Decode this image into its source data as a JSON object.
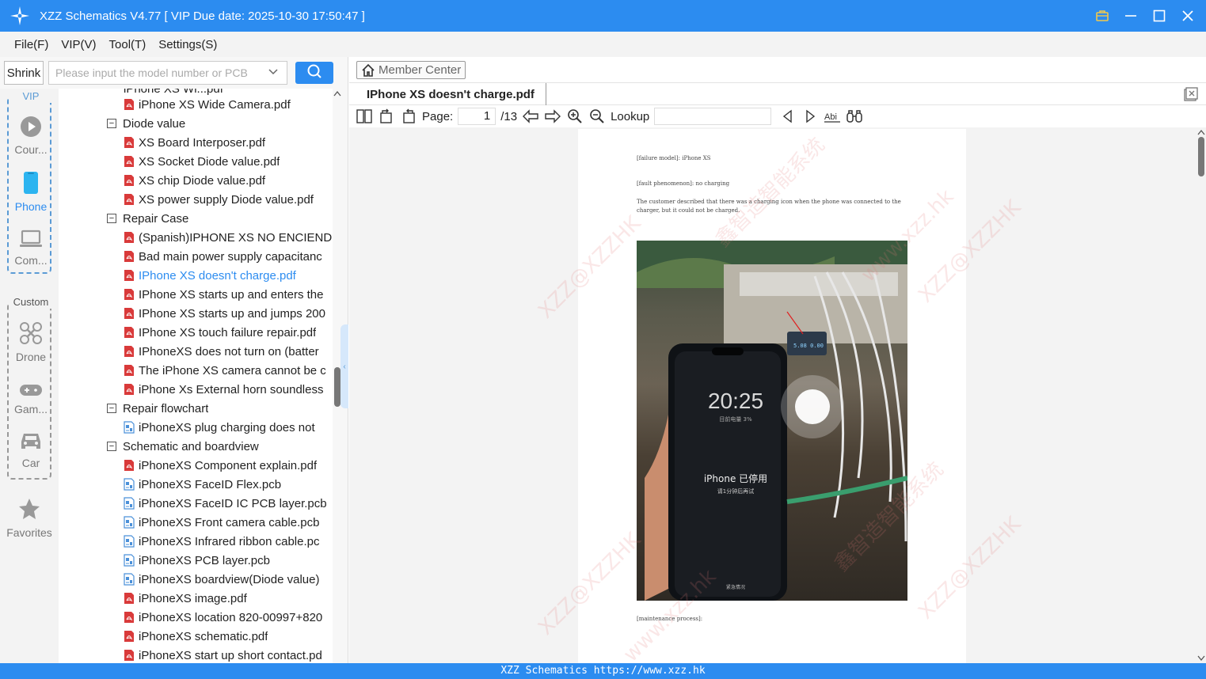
{
  "window": {
    "title": "XZZ Schematics V4.77 [ VIP Due date: 2025-10-30 17:50:47 ]",
    "icons": [
      "app-logo-icon",
      "vip-icon",
      "minimize-icon",
      "maximize-icon",
      "close-icon"
    ]
  },
  "menu": {
    "items": [
      "File(F)",
      "VIP(V)",
      "Tool(T)",
      "Settings(S)"
    ]
  },
  "search": {
    "shrink_label": "Shrink",
    "placeholder": "Please input the model number or PCB"
  },
  "sidebar": {
    "vip_group_title": "VIP",
    "custom_group_title": "Custom",
    "vip_items": [
      {
        "label": "Cour...",
        "icon": "play-icon"
      },
      {
        "label": "Phone",
        "icon": "phone-icon",
        "active": true
      },
      {
        "label": "Com...",
        "icon": "laptop-icon"
      }
    ],
    "custom_items": [
      {
        "label": "Drone",
        "icon": "drone-icon"
      },
      {
        "label": "Gam...",
        "icon": "gamepad-icon"
      },
      {
        "label": "Car",
        "icon": "car-icon"
      }
    ],
    "favorites_label": "Favorites"
  },
  "tree": {
    "cut_top": "iPhone XS Wi...pdf",
    "items": [
      {
        "type": "file",
        "kind": "pdf",
        "label": "iPhone XS Wide Camera.pdf"
      },
      {
        "type": "folder",
        "label": "Diode value"
      },
      {
        "type": "file",
        "kind": "pdf",
        "label": "XS Board Interposer.pdf"
      },
      {
        "type": "file",
        "kind": "pdf",
        "label": "XS Socket Diode value.pdf"
      },
      {
        "type": "file",
        "kind": "pdf",
        "label": "XS chip Diode value.pdf"
      },
      {
        "type": "file",
        "kind": "pdf",
        "label": "XS power supply Diode value.pdf"
      },
      {
        "type": "folder",
        "label": "Repair Case"
      },
      {
        "type": "file",
        "kind": "pdf",
        "label": "(Spanish)IPHONE XS NO ENCIEND"
      },
      {
        "type": "file",
        "kind": "pdf",
        "label": "Bad main power supply capacitanc"
      },
      {
        "type": "file",
        "kind": "pdf",
        "label": "IPhone XS doesn't charge.pdf",
        "selected": true
      },
      {
        "type": "file",
        "kind": "pdf",
        "label": "IPhone XS starts up and enters the"
      },
      {
        "type": "file",
        "kind": "pdf",
        "label": "IPhone XS starts up and jumps 200"
      },
      {
        "type": "file",
        "kind": "pdf",
        "label": "IPhone XS touch failure repair.pdf"
      },
      {
        "type": "file",
        "kind": "pdf",
        "label": "IPhoneXS does not turn on (batter"
      },
      {
        "type": "file",
        "kind": "pdf",
        "label": "The iPhone XS camera cannot be c"
      },
      {
        "type": "file",
        "kind": "pdf",
        "label": "iPhone Xs External horn soundless"
      },
      {
        "type": "folder",
        "label": "Repair flowchart"
      },
      {
        "type": "file",
        "kind": "pcb",
        "label": "iPhoneXS plug charging does not"
      },
      {
        "type": "folder",
        "label": "Schematic and boardview"
      },
      {
        "type": "file",
        "kind": "pdf",
        "label": "iPhoneXS Component explain.pdf"
      },
      {
        "type": "file",
        "kind": "pcb",
        "label": "iPhoneXS FaceID Flex.pcb"
      },
      {
        "type": "file",
        "kind": "pcb",
        "label": "iPhoneXS FaceID IC PCB layer.pcb"
      },
      {
        "type": "file",
        "kind": "pcb",
        "label": "iPhoneXS Front camera cable.pcb"
      },
      {
        "type": "file",
        "kind": "pcb",
        "label": "iPhoneXS Infrared ribbon cable.pc"
      },
      {
        "type": "file",
        "kind": "pcb",
        "label": "iPhoneXS PCB layer.pcb"
      },
      {
        "type": "file",
        "kind": "pcb",
        "label": "iPhoneXS boardview(Diode value)"
      },
      {
        "type": "file",
        "kind": "pdf",
        "label": "iPhoneXS image.pdf"
      },
      {
        "type": "file",
        "kind": "pdf",
        "label": "iPhoneXS location 820-00997+820"
      },
      {
        "type": "file",
        "kind": "pdf",
        "label": "iPhoneXS schematic.pdf"
      },
      {
        "type": "file",
        "kind": "pdf",
        "label": "iPhoneXS start up short contact.pd"
      }
    ]
  },
  "viewer": {
    "member_center_label": "Member Center",
    "tab_title": "IPhone XS doesn't charge.pdf",
    "page_label": "Page:",
    "page_current": "1",
    "page_total": "/13",
    "lookup_label": "Lookup",
    "toolbar_icons": [
      "two-page-icon",
      "rotate-left-icon",
      "rotate-right-icon",
      "prev-page-icon",
      "next-page-icon",
      "zoom-in-icon",
      "zoom-out-icon",
      "search-prev-icon",
      "search-next-icon",
      "match-case-icon",
      "find-binoculars-icon"
    ]
  },
  "document": {
    "line1": "[failure model]: iPhone XS",
    "line2": "[fault phenomenon]: no charging",
    "line3": "The customer described that there was a charging icon when the phone was connected to the charger, but it could not be charged.",
    "line4": "[maintenance process]:",
    "photo_time": "20:25",
    "photo_sub": "目前电量 3%",
    "photo_disabled": "iPhone 已停用",
    "photo_retry": "请1分钟后再试",
    "photo_emergency": "紧急情况",
    "meter_reading": "5.08 0.00",
    "watermarks": [
      "XZZ@XZZHK",
      "鑫智造智能系统",
      "www.xzz.hk"
    ]
  },
  "status": {
    "text": "XZZ Schematics https://www.xzz.hk"
  },
  "colors": {
    "accent": "#2c8cf0",
    "pdf_icon": "#d93a3a",
    "pcb_icon": "#4a90d9",
    "selected_text": "#2c8cf0"
  }
}
